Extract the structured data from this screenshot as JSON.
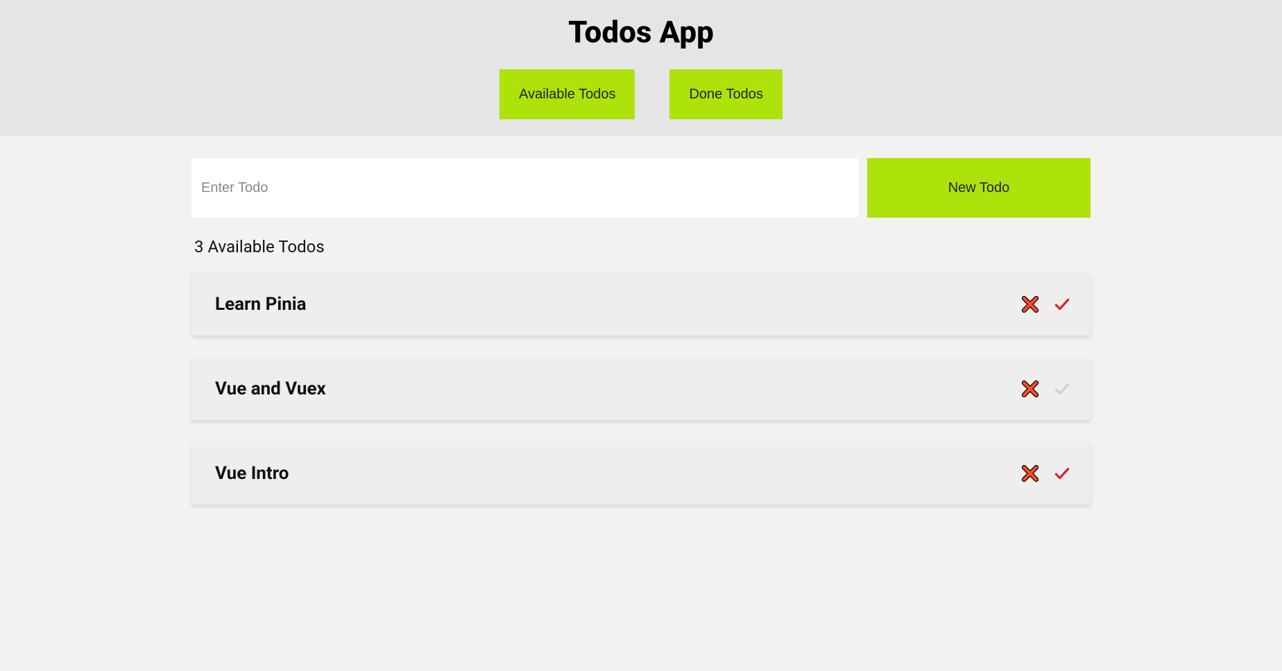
{
  "header": {
    "title": "Todos App",
    "tabs": {
      "available": "Available Todos",
      "done": "Done Todos"
    }
  },
  "input": {
    "placeholder": "Enter Todo",
    "value": "",
    "button_label": "New Todo"
  },
  "count_label": "3 Available Todos",
  "todos": [
    {
      "title": "Learn Pinia",
      "check_active": true
    },
    {
      "title": "Vue and Vuex",
      "check_active": false
    },
    {
      "title": "Vue Intro",
      "check_active": true
    }
  ],
  "colors": {
    "accent": "#aee20b",
    "delete_fill": "#ff4c2b",
    "check_active": "#d8222a",
    "check_inactive": "#cfcfcf"
  }
}
